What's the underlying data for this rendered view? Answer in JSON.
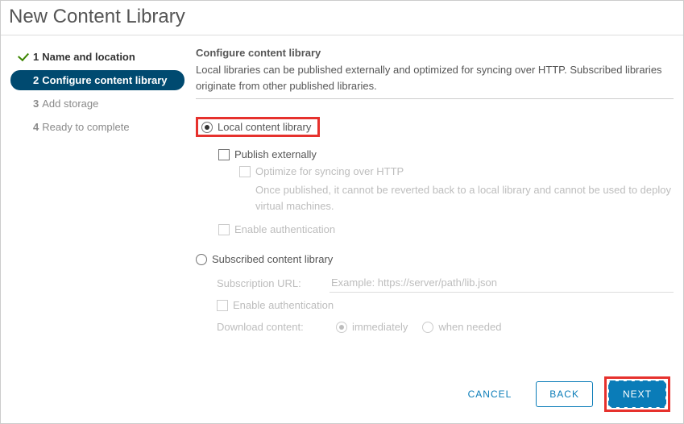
{
  "title": "New Content Library",
  "steps": [
    {
      "num": "1",
      "label": "Name and location"
    },
    {
      "num": "2",
      "label": "Configure content library"
    },
    {
      "num": "3",
      "label": "Add storage"
    },
    {
      "num": "4",
      "label": "Ready to complete"
    }
  ],
  "section": {
    "title": "Configure content library",
    "desc": "Local libraries can be published externally and optimized for syncing over HTTP. Subscribed libraries originate from other published libraries."
  },
  "local": {
    "label": "Local content library",
    "publish": "Publish externally",
    "optimize": "Optimize for syncing over HTTP",
    "optimize_help": "Once published, it cannot be reverted back to a local library and cannot be used to deploy virtual machines.",
    "auth": "Enable authentication"
  },
  "subscribed": {
    "label": "Subscribed content library",
    "url_label": "Subscription URL:",
    "url_placeholder": "Example: https://server/path/lib.json",
    "auth": "Enable authentication",
    "download_label": "Download content:",
    "immediately": "immediately",
    "when_needed": "when needed"
  },
  "buttons": {
    "cancel": "CANCEL",
    "back": "BACK",
    "next": "NEXT"
  }
}
